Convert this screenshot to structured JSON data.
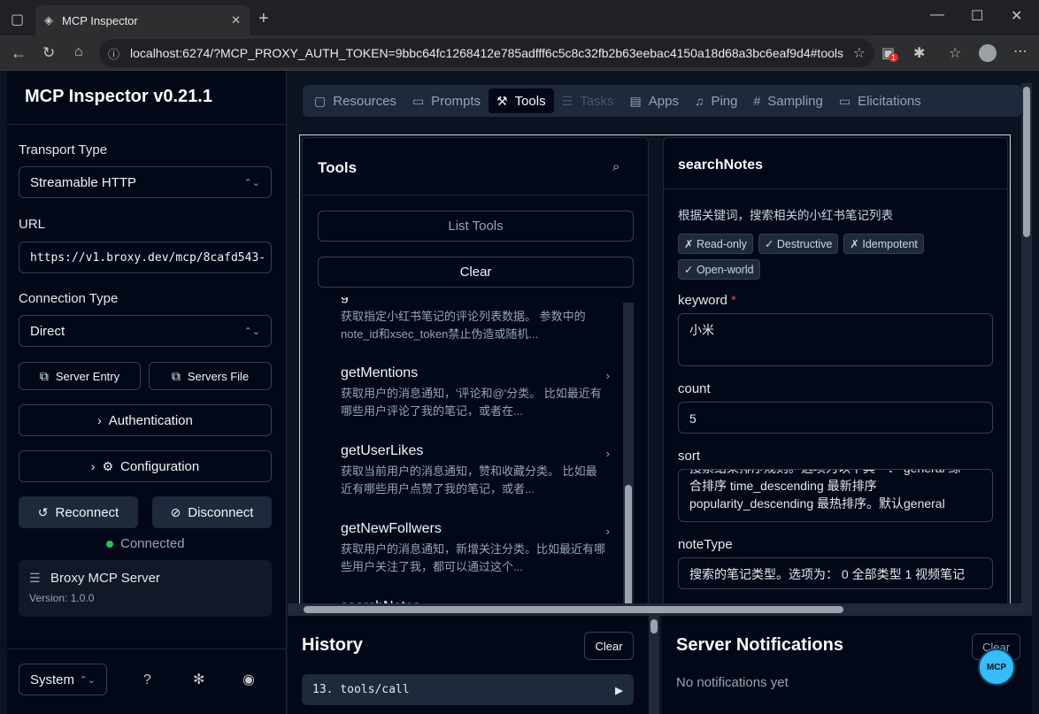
{
  "browser": {
    "tab_title": "MCP Inspector",
    "url": "localhost:6274/?MCP_PROXY_AUTH_TOKEN=9bbc64fc1268412e785adfff6c5c8c32fb2b63eebac4150a18d68a3bc6eaf9d4#tools",
    "ext_badge": "1"
  },
  "sidebar": {
    "title": "MCP Inspector v0.21.1",
    "transport_label": "Transport Type",
    "transport_value": "Streamable HTTP",
    "url_label": "URL",
    "url_value": "https://v1.broxy.dev/mcp/8cafd543-",
    "connection_label": "Connection Type",
    "connection_value": "Direct",
    "server_entry": "Server Entry",
    "servers_file": "Servers File",
    "authentication": "Authentication",
    "configuration": "Configuration",
    "reconnect": "Reconnect",
    "disconnect": "Disconnect",
    "status": "Connected",
    "status_color": "#22c55e",
    "server_name": "Broxy MCP Server",
    "server_version": "Version: 1.0.0",
    "theme": "System"
  },
  "tabs": [
    {
      "label": "Resources",
      "icon": "file-icon"
    },
    {
      "label": "Prompts",
      "icon": "message-icon"
    },
    {
      "label": "Tools",
      "icon": "hammer-icon",
      "active": true
    },
    {
      "label": "Tasks",
      "icon": "list-icon",
      "disabled": true
    },
    {
      "label": "Apps",
      "icon": "app-window-icon"
    },
    {
      "label": "Ping",
      "icon": "bell-icon"
    },
    {
      "label": "Sampling",
      "icon": "hash-icon"
    },
    {
      "label": "Elicitations",
      "icon": "message-square-icon"
    }
  ],
  "tools_panel": {
    "title": "Tools",
    "list_tools": "List Tools",
    "clear": "Clear",
    "items": [
      {
        "name": "g",
        "desc": "获取指定小红书笔记的评论列表数据。 参数中的note_id和xsec_token禁止伪造或随机..."
      },
      {
        "name": "getMentions",
        "desc": "获取用户的消息通知，'评论和@'分类。 比如最近有哪些用户评论了我的笔记，或者在..."
      },
      {
        "name": "getUserLikes",
        "desc": "获取当前用户的消息通知，赞和收藏分类。 比如最近有哪些用户点赞了我的笔记，或者..."
      },
      {
        "name": "getNewFollwers",
        "desc": "获取用户的消息通知，新增关注分类。比如最近有哪些用户关注了我，都可以通过这个..."
      },
      {
        "name": "searchNotes",
        "desc": ""
      }
    ]
  },
  "detail_panel": {
    "title": "searchNotes",
    "description": "根据关键词，搜索相关的小红书笔记列表",
    "badges": [
      "✗ Read-only",
      "✓ Destructive",
      "✗ Idempotent",
      "✓ Open-world"
    ],
    "fields": [
      {
        "label": "keyword",
        "required": true,
        "value": "小米"
      },
      {
        "label": "count",
        "required": false,
        "value": "5"
      },
      {
        "label": "sort",
        "required": false,
        "value": "搜索结果排序规则。选项为以下其一： general 综合排序 time_descending 最新排序 popularity_descending 最热排序。默认general"
      },
      {
        "label": "noteType",
        "required": false,
        "value": "搜索的笔记类型。选项为： 0 全部类型 1 视频笔记"
      }
    ]
  },
  "history": {
    "title": "History",
    "clear": "Clear",
    "entry": "13. tools/call"
  },
  "notifications": {
    "title": "Server Notifications",
    "clear": "Clear",
    "empty": "No notifications yet",
    "logo_text": "MCP"
  }
}
